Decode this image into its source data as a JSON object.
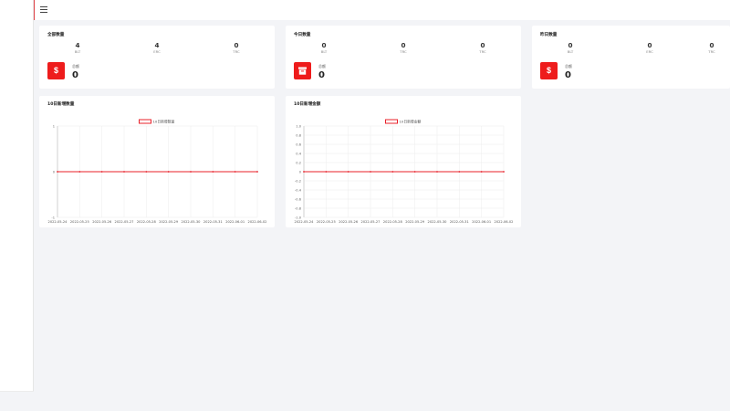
{
  "stats_cards": [
    {
      "title": "全部数量",
      "stats": [
        {
          "value": "4",
          "label": "BLT"
        },
        {
          "value": "4",
          "label": "ERC"
        },
        {
          "value": "0",
          "label": "TRC"
        }
      ],
      "icon": "dollar-icon",
      "sum_label": "总额",
      "sum_value": "0"
    },
    {
      "title": "今日数量",
      "stats": [
        {
          "value": "0",
          "label": "BLT"
        },
        {
          "value": "0",
          "label": "TRC"
        },
        {
          "value": "0",
          "label": "TRC"
        }
      ],
      "icon": "archive-icon",
      "sum_label": "总额",
      "sum_value": "0"
    },
    {
      "title": "昨日数量",
      "stats": [
        {
          "value": "0",
          "label": "BLT"
        },
        {
          "value": "0",
          "label": "ERC"
        },
        {
          "value": "0",
          "label": "TRC"
        }
      ],
      "icon": "dollar-icon",
      "sum_label": "总额",
      "sum_value": "0"
    }
  ],
  "icon_glyphs": {
    "dollar": "$"
  },
  "colors": {
    "accent": "#ee1c1c",
    "line": "#e8202a"
  },
  "chart_data": [
    {
      "type": "line",
      "title": "10日新增数量",
      "categories": [
        "2022-05-24",
        "2022-05-25",
        "2022-05-26",
        "2022-05-27",
        "2022-05-28",
        "2022-05-29",
        "2022-05-30",
        "2022-05-31",
        "2022-06-01",
        "2022-06-02"
      ],
      "series": [
        {
          "name": "10日新增数量",
          "values": [
            0,
            0,
            0,
            0,
            0,
            0,
            0,
            0,
            0,
            0
          ]
        }
      ],
      "yticks": [
        "1",
        "0",
        "-1"
      ],
      "ylim": [
        -1,
        1
      ],
      "grid": true,
      "legend": "top-center"
    },
    {
      "type": "line",
      "title": "10日新增金额",
      "categories": [
        "2022-05-24",
        "2022-05-25",
        "2022-05-26",
        "2022-05-27",
        "2022-05-28",
        "2022-05-29",
        "2022-05-30",
        "2022-05-31",
        "2022-06-01",
        "2022-06-02"
      ],
      "series": [
        {
          "name": "10日新增金额",
          "values": [
            0,
            0,
            0,
            0,
            0,
            0,
            0,
            0,
            0,
            0
          ]
        }
      ],
      "yticks": [
        "1.0",
        "0.8",
        "0.6",
        "0.4",
        "0.2",
        "0",
        "-0.2",
        "-0.4",
        "-0.6",
        "-0.8",
        "-1.0"
      ],
      "ylim": [
        -1,
        1
      ],
      "grid": true,
      "legend": "top-center"
    }
  ]
}
